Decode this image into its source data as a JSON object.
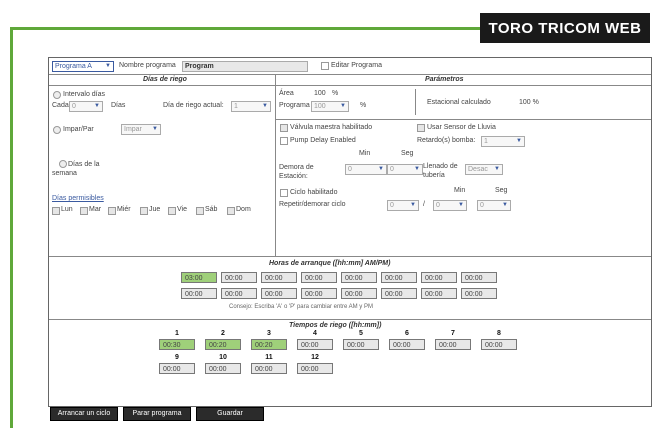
{
  "brand": "TORO TRICOM WEB",
  "program": {
    "select_value": "Programa A",
    "name_label": "Nombre programa",
    "name_value": "Program",
    "edit_label": "Editar Programa"
  },
  "riego": {
    "title": "Días de riego",
    "intervalo_label": "Intervalo días",
    "cada_label": "Cada",
    "cada_value": "0",
    "dias_label": "Días",
    "dia_actual_label": "Día de riego actual:",
    "dia_actual_value": "1",
    "imparpar_label": "Impar/Par",
    "imparpar_value": "Impar",
    "dias_semana_label": "Días de la semana",
    "permisibles_label": "Días permisibles",
    "days": [
      "Lun",
      "Mar",
      "Miér",
      "Jue",
      "Vie",
      "Sáb",
      "Dom"
    ]
  },
  "params": {
    "title": "Parámetros",
    "area_label": "Área",
    "area_value": "100",
    "area_unit": "%",
    "programa_label": "Programa",
    "programa_value": "100",
    "programa_unit": "%",
    "estacional_label": "Estacional calculado",
    "estacional_value": "100 %",
    "valvula_label": "Válvula maestra habilitado",
    "sensor_label": "Usar Sensor de Lluvia",
    "pump_label": "Pump Delay Enabled",
    "retardo_label": "Retardo(s) bomba:",
    "retardo_value": "1",
    "min_label": "Min",
    "seg_label": "Seg",
    "demora_label": "Demora de Estación:",
    "demora_min": "0",
    "demora_seg": "0",
    "llenado_label": "Llenado de tubería",
    "llenado_value": "Desac",
    "ciclo_label": "Ciclo habilitado",
    "repetir_label": "Repetir/demorar ciclo",
    "repetir_a": "0",
    "repetir_sep": "/",
    "repetir_min": "0",
    "repetir_seg": "0"
  },
  "horas": {
    "title": "Horas de arranque ([hh:mm] AM/PM)",
    "row1": [
      "03:00",
      "00:00",
      "00:00",
      "00:00",
      "00:00",
      "00:00",
      "00:00",
      "00:00"
    ],
    "row2": [
      "00:00",
      "00:00",
      "00:00",
      "00:00",
      "00:00",
      "00:00",
      "00:00",
      "00:00"
    ],
    "hint": "Consejo: Escriba 'A' o 'P' para cambiar entre AM y PM"
  },
  "tiempos": {
    "title": "Tiempos de riego ([hh:mm])",
    "row1_nums": [
      "1",
      "2",
      "3",
      "4",
      "5",
      "6",
      "7",
      "8"
    ],
    "row1_vals": [
      "00:30",
      "00:20",
      "00:20",
      "00:00",
      "00:00",
      "00:00",
      "00:00",
      "00:00"
    ],
    "row2_nums": [
      "9",
      "10",
      "11",
      "12"
    ],
    "row2_vals": [
      "00:00",
      "00:00",
      "00:00",
      "00:00"
    ]
  },
  "buttons": {
    "arrancar": "Arrancar un ciclo",
    "parar": "Parar programa",
    "guardar": "Guardar"
  },
  "colors": {
    "accent_green": "#5fa83a",
    "active_cell": "#9fd07a",
    "brand_bg": "#1a1a1a"
  }
}
